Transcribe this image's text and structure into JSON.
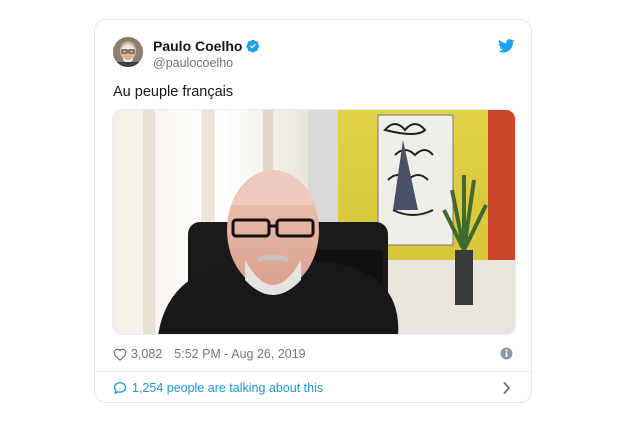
{
  "tweet": {
    "author_name": "Paulo Coelho",
    "author_handle": "@paulocoelho",
    "text": "Au peuple français",
    "likes": "3,082",
    "timestamp": "5:52 PM - Aug 26, 2019",
    "conversation": "1,254 people are talking about this",
    "brand_color": "#1da1f2",
    "link_color": "#1b95e0",
    "icons": [
      "twitter-bird-icon",
      "verified-badge-icon",
      "heart-icon",
      "info-icon",
      "speech-bubble-icon",
      "chevron-right-icon"
    ]
  }
}
